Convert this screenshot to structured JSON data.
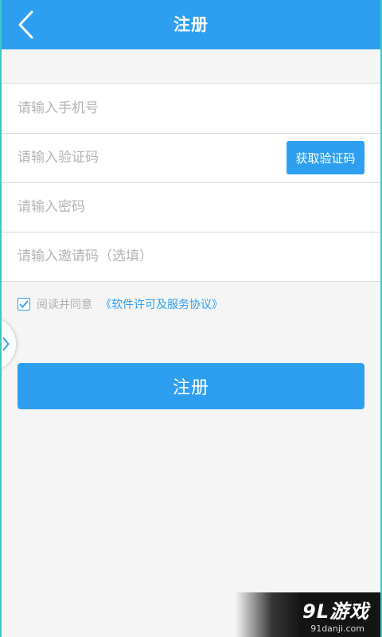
{
  "header": {
    "title": "注册"
  },
  "form": {
    "phone": {
      "placeholder": "请输入手机号",
      "value": ""
    },
    "code": {
      "placeholder": "请输入验证码",
      "value": "",
      "button_label": "获取验证码"
    },
    "password": {
      "placeholder": "请输入密码",
      "value": ""
    },
    "invite": {
      "placeholder": "请输入邀请码（选填）",
      "value": ""
    }
  },
  "agreement": {
    "checked": true,
    "text": "阅读并同意",
    "link_text": "《软件许可及服务协议》"
  },
  "submit": {
    "label": "注册"
  },
  "watermark": {
    "main": "9L游戏",
    "sub": "91danji.com"
  },
  "colors": {
    "primary": "#2e9ff0",
    "background": "#f5f5f5",
    "frame": "#3ec9c0"
  },
  "icons": {
    "back": "chevron-left-icon",
    "side_tab": "chevron-right-icon",
    "checkbox": "check-icon"
  }
}
